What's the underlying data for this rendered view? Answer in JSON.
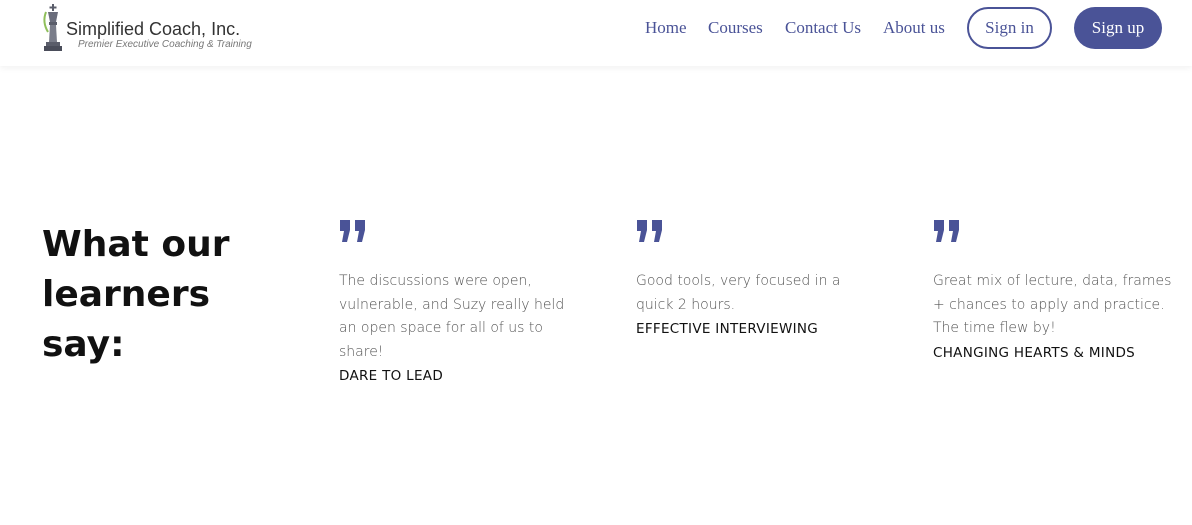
{
  "brand": {
    "name": "Simplified Coach, Inc.",
    "tagline": "Premier Executive Coaching & Training"
  },
  "nav": {
    "items": [
      "Home",
      "Courses",
      "Contact Us",
      "About us"
    ],
    "signin_label": "Sign in",
    "signup_label": "Sign up"
  },
  "colors": {
    "accent": "#4a5397"
  },
  "section": {
    "heading": "What our learners say:"
  },
  "testimonials": [
    {
      "icon": "quote-icon",
      "text": "The discussions were open, vulnerable, and Suzy really held an open space for all of us to share!",
      "course": "DARE TO LEAD"
    },
    {
      "icon": "quote-icon",
      "text": "Good tools, very focused in a quick 2 hours.",
      "course": "EFFECTIVE INTERVIEWING"
    },
    {
      "icon": "quote-icon",
      "text": "Great mix of lecture, data, frames + chances to apply and practice. The time flew by!",
      "course": "CHANGING HEARTS & MINDS"
    }
  ]
}
